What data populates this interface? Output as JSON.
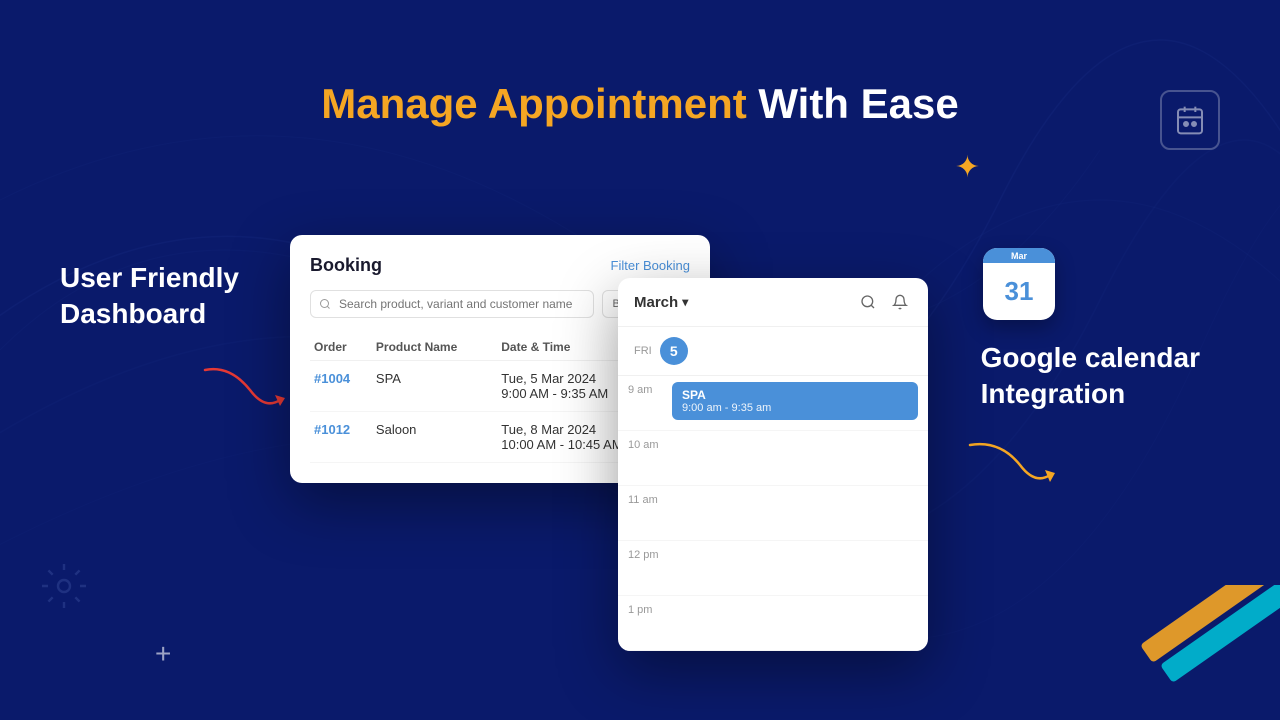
{
  "page": {
    "background_color": "#0a1a6b"
  },
  "heading": {
    "orange_part": "Manage Appointment",
    "white_part": "With Ease"
  },
  "left_section": {
    "line1": "User Friendly",
    "line2": "Dashboard"
  },
  "right_section": {
    "line1": "Google calendar",
    "line2": "Integration"
  },
  "booking_card": {
    "title": "Booking",
    "filter_label": "Filter Booking",
    "search_placeholder": "Search product, variant and customer name",
    "booking_type_label": "Booking Type",
    "table": {
      "headers": [
        "Order",
        "Product Name",
        "Date & Time",
        ""
      ],
      "rows": [
        {
          "order": "#1004",
          "product": "SPA",
          "date": "Tue, 5 Mar 2024",
          "time": "9:00 AM - 9:35 AM"
        },
        {
          "order": "#1012",
          "product": "Saloon",
          "date": "Tue, 8 Mar 2024",
          "time": "10:00 AM - 10:45 AM"
        }
      ]
    }
  },
  "calendar_card": {
    "month": "March",
    "day_label": "Fri",
    "day_number": "5",
    "time_slots": [
      {
        "label": "9 am",
        "event": {
          "title": "SPA",
          "time": "9:00 am - 9:35 am"
        }
      },
      {
        "label": "10 am",
        "event": null
      },
      {
        "label": "11 am",
        "event": null
      },
      {
        "label": "12 pm",
        "event": null
      },
      {
        "label": "1 pm",
        "event": null
      }
    ]
  },
  "gcal_icon": {
    "top_text": "Mar",
    "number": "31"
  },
  "decorations": {
    "plus": "+",
    "star": "✦"
  }
}
